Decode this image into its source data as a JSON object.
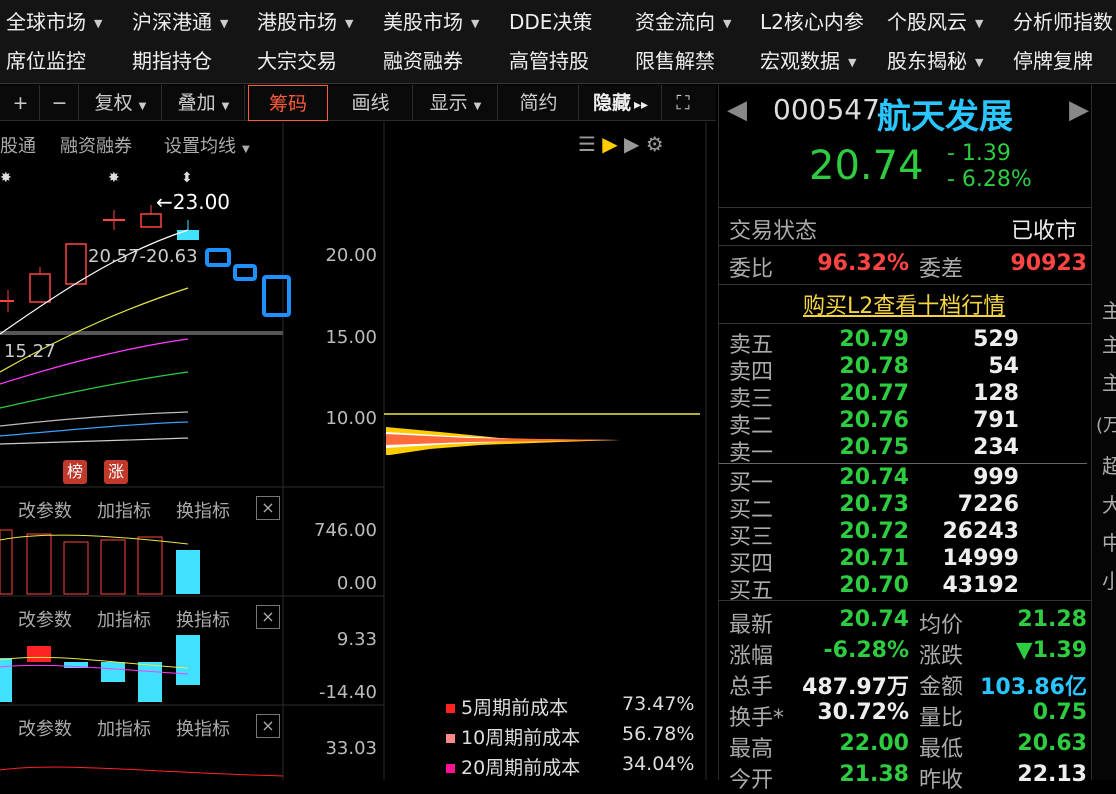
{
  "nav": {
    "row1": [
      {
        "label": "全球市场",
        "caret": true
      },
      {
        "label": "沪深港通",
        "caret": true
      },
      {
        "label": "港股市场",
        "caret": true
      },
      {
        "label": "美股市场",
        "caret": true
      },
      {
        "label": "DDE决策",
        "caret": false
      },
      {
        "label": "资金流向",
        "caret": true
      },
      {
        "label": "L2核心内参",
        "caret": false
      },
      {
        "label": "个股风云",
        "caret": true
      },
      {
        "label": "分析师指数",
        "caret": false
      }
    ],
    "row2": [
      {
        "label": "席位监控",
        "caret": false
      },
      {
        "label": "期指持仓",
        "caret": false
      },
      {
        "label": "大宗交易",
        "caret": false
      },
      {
        "label": "融资融券",
        "caret": false
      },
      {
        "label": "高管持股",
        "caret": false
      },
      {
        "label": "限售解禁",
        "caret": false
      },
      {
        "label": "宏观数据",
        "caret": true
      },
      {
        "label": "股东揭秘",
        "caret": true
      },
      {
        "label": "停牌复牌",
        "caret": false
      }
    ]
  },
  "toolbar": {
    "plus": "+",
    "minus": "−",
    "fuquan": "复权",
    "diejia": "叠加",
    "chouma": "筹码",
    "huaxian": "画线",
    "xianshi": "显示",
    "jianyue": "简约",
    "yincang": "隐藏",
    "yincang_arrows": "▸▸",
    "fullscreen": "⛶"
  },
  "chart_header": {
    "tab1": "股通",
    "tab2": "融资融券",
    "tab3": "设置均线"
  },
  "kline": {
    "high_annot": "←23.00",
    "range_annot": "20.57-20.63",
    "low_annot": "15.27",
    "y_ticks": [
      "20.00",
      "15.00",
      "10.00"
    ],
    "badge1": "榜",
    "badge2": "涨"
  },
  "sub_panels": [
    {
      "btn1": "改参数",
      "btn2": "加指标",
      "btn3": "换指标",
      "close": "×",
      "y_top": "746.00",
      "y_bottom": "0.00"
    },
    {
      "btn1": "改参数",
      "btn2": "加指标",
      "btn3": "换指标",
      "close": "×",
      "y_top": "9.33",
      "y_bottom": "-14.40"
    },
    {
      "btn1": "改参数",
      "btn2": "加指标",
      "btn3": "换指标",
      "close": "×",
      "y_top": "33.03"
    }
  ],
  "chouma_legend": [
    {
      "label": "5周期前成本",
      "value": "73.47%",
      "color": "#ff2222"
    },
    {
      "label": "10周期前成本",
      "value": "56.78%",
      "color": "#ff8888"
    },
    {
      "label": "20周期前成本",
      "value": "34.04%",
      "color": "#ff1493"
    }
  ],
  "quote": {
    "code": "000547",
    "name": "航天发展",
    "price": "20.74",
    "change": "- 1.39",
    "change_pct": "- 6.28%",
    "nav_left": "◀",
    "nav_right": "▶",
    "status_label": "交易状态",
    "status_value": "已收市",
    "weibi_label": "委比",
    "weibi_value": "96.32%",
    "weicha_label": "委差",
    "weicha_value": "90923",
    "l2_link": "购买L2查看十档行情"
  },
  "order_book": {
    "asks": [
      {
        "label": "卖五",
        "price": "20.79",
        "vol": "529"
      },
      {
        "label": "卖四",
        "price": "20.78",
        "vol": "54"
      },
      {
        "label": "卖三",
        "price": "20.77",
        "vol": "128"
      },
      {
        "label": "卖二",
        "price": "20.76",
        "vol": "791"
      },
      {
        "label": "卖一",
        "price": "20.75",
        "vol": "234"
      }
    ],
    "bids": [
      {
        "label": "买一",
        "price": "20.74",
        "vol": "999"
      },
      {
        "label": "买二",
        "price": "20.73",
        "vol": "7226"
      },
      {
        "label": "买三",
        "price": "20.72",
        "vol": "26243"
      },
      {
        "label": "买四",
        "price": "20.71",
        "vol": "14999"
      },
      {
        "label": "买五",
        "price": "20.70",
        "vol": "43192"
      }
    ]
  },
  "stats": [
    {
      "l1": "最新",
      "v1": "20.74",
      "c1": "g",
      "l2": "均价",
      "v2": "21.28",
      "c2": "g"
    },
    {
      "l1": "涨幅",
      "v1": "-6.28%",
      "c1": "g",
      "l2": "涨跌",
      "v2": "▼1.39",
      "c2": "g"
    },
    {
      "l1": "总手",
      "v1": "487.97万",
      "c1": "w",
      "l2": "金额",
      "v2": "103.86亿",
      "c2": "c"
    },
    {
      "l1": "换手*",
      "v1": "30.72%",
      "c1": "w",
      "l2": "量比",
      "v2": "0.75",
      "c2": "g"
    },
    {
      "l1": "最高",
      "v1": "22.00",
      "c1": "g",
      "l2": "最低",
      "v2": "20.63",
      "c2": "g"
    },
    {
      "l1": "今开",
      "v1": "21.38",
      "c1": "g",
      "l2": "昨收",
      "v2": "22.13",
      "c2": "w"
    }
  ],
  "side_cut": [
    "主",
    "主",
    "主",
    "(万",
    "超",
    "大",
    "中",
    "小"
  ]
}
